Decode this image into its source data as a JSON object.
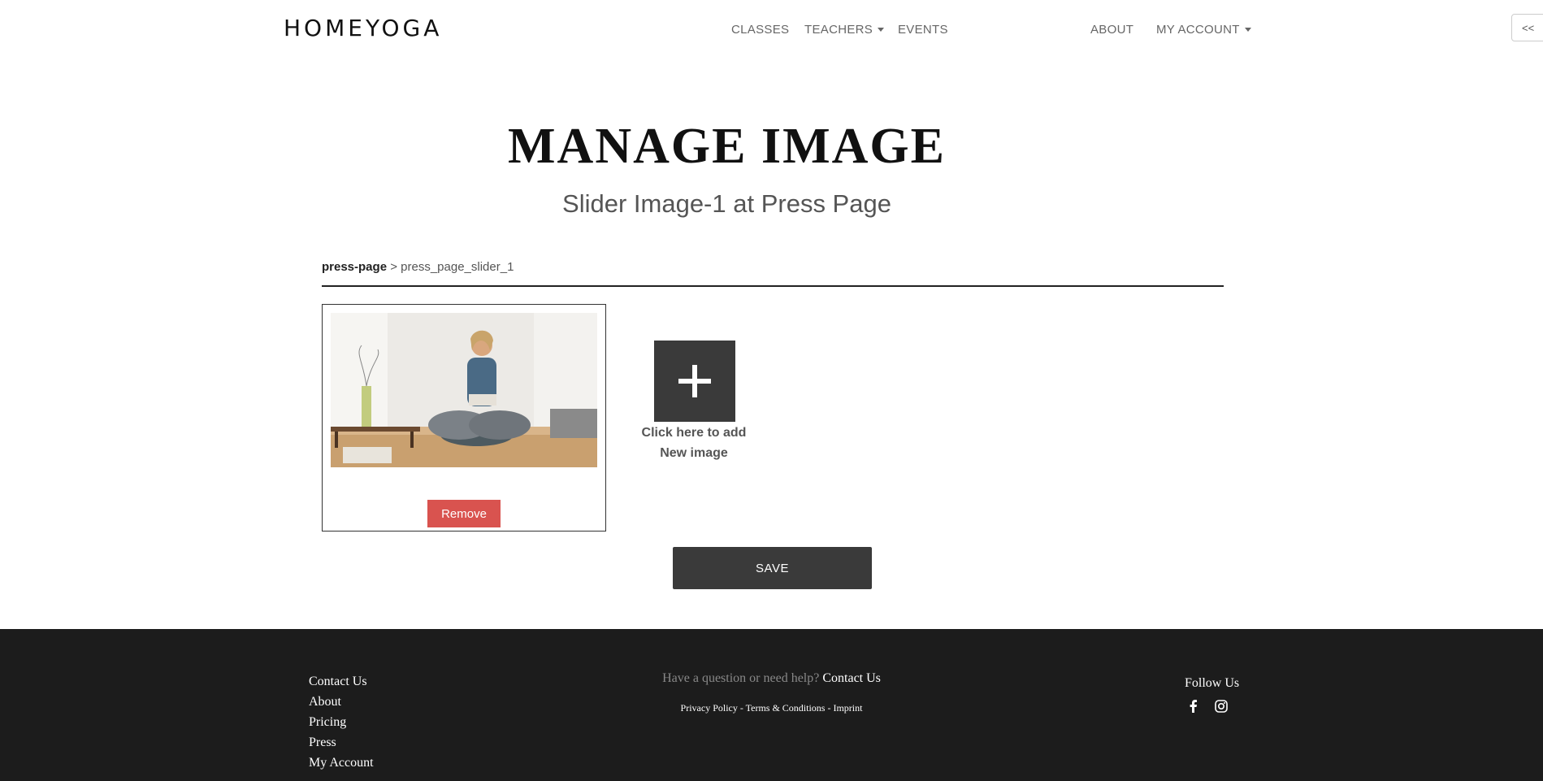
{
  "header": {
    "logo": "HOMEYOGA",
    "nav": {
      "classes": "CLASSES",
      "teachers": "TEACHERS",
      "events": "EVENTS",
      "about": "ABOUT",
      "my_account": "MY ACCOUNT"
    },
    "collapse_label": "<<"
  },
  "main": {
    "title": "MANAGE IMAGE",
    "subtitle": "Slider Image-1 at Press Page",
    "breadcrumb": {
      "parent": "press-page",
      "separator": " > ",
      "current": "press_page_slider_1"
    },
    "image_card": {
      "remove_label": "Remove"
    },
    "add_image": {
      "line1": "Click here to add",
      "line2": "New image"
    },
    "save_label": "SAVE"
  },
  "footer": {
    "links": [
      "Contact Us",
      "About",
      "Pricing",
      "Press",
      "My Account"
    ],
    "help_text": "Have a question or need help?",
    "help_link": "Contact Us",
    "legal": {
      "privacy": "Privacy Policy",
      "terms": "Terms & Conditions",
      "imprint": "Imprint",
      "separator": " - "
    },
    "follow_label": "Follow Us",
    "social_icons": [
      "facebook-icon",
      "instagram-icon"
    ]
  },
  "colors": {
    "remove_button": "#d9534f",
    "dark_button": "#3a3a3a",
    "footer_bg": "#1c1c1c"
  }
}
